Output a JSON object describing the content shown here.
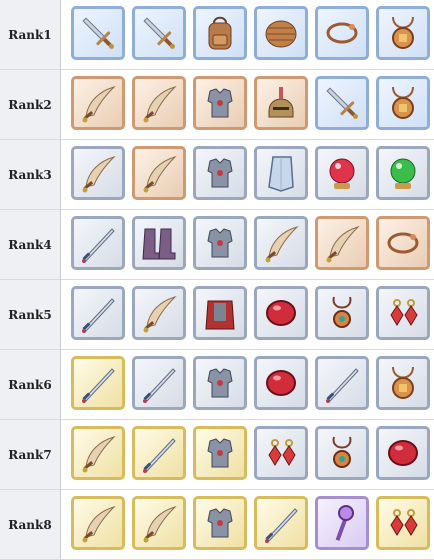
{
  "ranks": [
    {
      "label": "Rank1",
      "items": [
        {
          "icon": "sword-icon",
          "tier": "blue"
        },
        {
          "icon": "sword-icon",
          "tier": "blue"
        },
        {
          "icon": "backpack-icon",
          "tier": "blue"
        },
        {
          "icon": "shield-icon",
          "tier": "blue"
        },
        {
          "icon": "bracelet-icon",
          "tier": "blue"
        },
        {
          "icon": "amulet-icon",
          "tier": "blue"
        }
      ]
    },
    {
      "label": "Rank2",
      "items": [
        {
          "icon": "scimitar-icon",
          "tier": "bronze"
        },
        {
          "icon": "scimitar-icon",
          "tier": "bronze"
        },
        {
          "icon": "armor-icon",
          "tier": "bronze"
        },
        {
          "icon": "helmet-icon",
          "tier": "bronze"
        },
        {
          "icon": "sword-icon",
          "tier": "blue"
        },
        {
          "icon": "amulet-icon",
          "tier": "blue"
        }
      ]
    },
    {
      "label": "Rank3",
      "items": [
        {
          "icon": "scimitar-icon",
          "tier": "silver"
        },
        {
          "icon": "scimitar-icon",
          "tier": "bronze"
        },
        {
          "icon": "armor-icon",
          "tier": "silver"
        },
        {
          "icon": "tower-shield-icon",
          "tier": "silver"
        },
        {
          "icon": "red-orb-icon",
          "tier": "silver"
        },
        {
          "icon": "green-orb-icon",
          "tier": "silver"
        }
      ]
    },
    {
      "label": "Rank4",
      "items": [
        {
          "icon": "katana-icon",
          "tier": "silver"
        },
        {
          "icon": "boots-icon",
          "tier": "silver"
        },
        {
          "icon": "armor-icon",
          "tier": "silver"
        },
        {
          "icon": "scimitar-icon",
          "tier": "silver"
        },
        {
          "icon": "scimitar-icon",
          "tier": "bronze"
        },
        {
          "icon": "bracelet-icon",
          "tier": "bronze"
        }
      ]
    },
    {
      "label": "Rank5",
      "items": [
        {
          "icon": "katana-icon",
          "tier": "silver"
        },
        {
          "icon": "scimitar-icon",
          "tier": "silver"
        },
        {
          "icon": "cape-armor-icon",
          "tier": "silver"
        },
        {
          "icon": "ruby-icon",
          "tier": "silver"
        },
        {
          "icon": "pendant-icon",
          "tier": "silver"
        },
        {
          "icon": "earring-icon",
          "tier": "silver"
        }
      ]
    },
    {
      "label": "Rank6",
      "items": [
        {
          "icon": "katana-icon",
          "tier": "gold"
        },
        {
          "icon": "katana-icon",
          "tier": "silver"
        },
        {
          "icon": "armor-icon",
          "tier": "silver"
        },
        {
          "icon": "ruby-icon",
          "tier": "silver"
        },
        {
          "icon": "katana-icon",
          "tier": "silver"
        },
        {
          "icon": "amulet-icon",
          "tier": "silver"
        }
      ]
    },
    {
      "label": "Rank7",
      "items": [
        {
          "icon": "scimitar-icon",
          "tier": "gold"
        },
        {
          "icon": "katana-icon",
          "tier": "gold"
        },
        {
          "icon": "armor-icon",
          "tier": "gold"
        },
        {
          "icon": "earring-icon",
          "tier": "silver"
        },
        {
          "icon": "pendant-icon",
          "tier": "silver"
        },
        {
          "icon": "ruby-icon",
          "tier": "silver"
        }
      ]
    },
    {
      "label": "Rank8",
      "items": [
        {
          "icon": "scimitar-icon",
          "tier": "gold"
        },
        {
          "icon": "scimitar-icon",
          "tier": "gold"
        },
        {
          "icon": "armor-icon",
          "tier": "gold"
        },
        {
          "icon": "katana-icon",
          "tier": "gold"
        },
        {
          "icon": "staff-icon",
          "tier": "purple"
        },
        {
          "icon": "earring-icon",
          "tier": "gold"
        }
      ]
    }
  ]
}
